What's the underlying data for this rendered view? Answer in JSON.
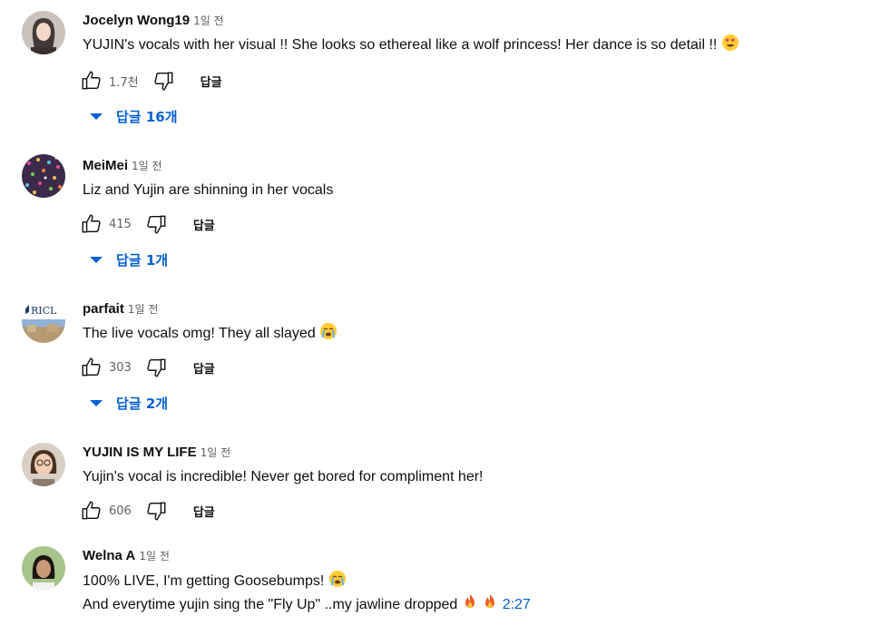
{
  "comments": [
    {
      "author": "Jocelyn Wong19",
      "time": "1일 전",
      "lines": [
        "YUJIN's vocals with her visual !! She looks so ethereal like a wolf princess! Her dance is so detail !!"
      ],
      "emoji": "heart-eyes-emoji",
      "likes": "1.7천",
      "reply_label": "답글",
      "replies_label": "답글 16개"
    },
    {
      "author": "MeiMei",
      "time": "1일 전",
      "lines": [
        "Liz and Yujin are shinning in her vocals"
      ],
      "likes": "415",
      "reply_label": "답글",
      "replies_label": "답글 1개"
    },
    {
      "author": "parfait",
      "time": "1일 전",
      "lines": [
        "The live vocals omg! They all slayed"
      ],
      "emoji": "crying-emoji",
      "likes": "303",
      "reply_label": "답글",
      "replies_label": "답글 2개",
      "avatar_text": "RICL"
    },
    {
      "author": "YUJIN IS MY LIFE",
      "time": "1일 전",
      "lines": [
        "Yujin's vocal is incredible! Never get bored for compliment her!"
      ],
      "likes": "606",
      "reply_label": "답글"
    },
    {
      "author": "Welna A",
      "time": "1일 전",
      "lines": [
        "100% LIVE,  I'm getting Goosebumps!",
        "And everytime yujin sing the \"Fly Up\" ..my jawline dropped"
      ],
      "emoji": "crying-emoji",
      "line2_emoji": "fire-emoji",
      "timestamp": "2:27"
    }
  ],
  "colors": {
    "link": "#065fd4",
    "meta": "#606060",
    "text": "#0f0f0f"
  },
  "icons": {
    "like": "thumbs-up-icon",
    "dislike": "thumbs-down-icon",
    "expand": "caret-down-icon"
  }
}
